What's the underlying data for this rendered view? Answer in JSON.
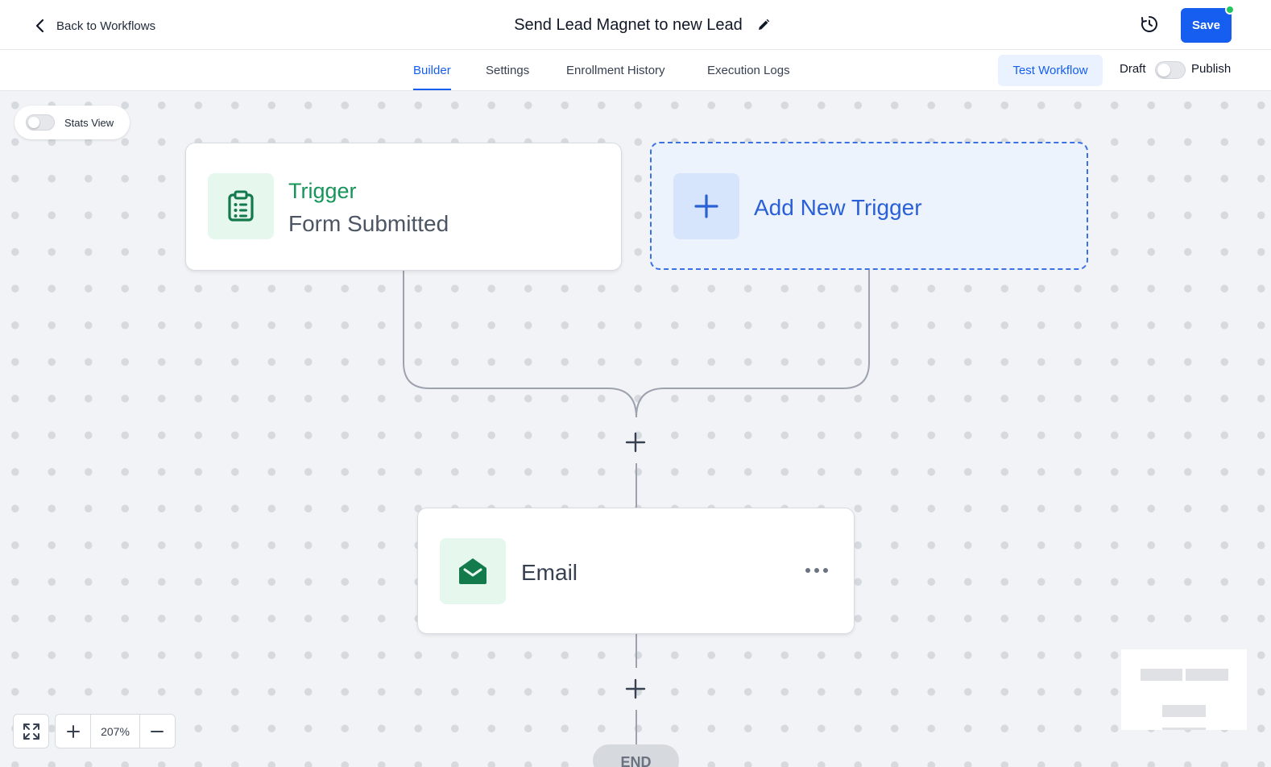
{
  "header": {
    "back_label": "Back to Workflows",
    "title": "Send Lead Magnet to new Lead",
    "save_label": "Save"
  },
  "tabs": [
    {
      "label": "Builder",
      "active": true
    },
    {
      "label": "Settings",
      "active": false
    },
    {
      "label": "Enrollment History",
      "active": false
    },
    {
      "label": "Execution Logs",
      "active": false
    }
  ],
  "toolbar": {
    "test_label": "Test Workflow",
    "draft_label": "Draft",
    "publish_label": "Publish",
    "published": false
  },
  "canvas": {
    "stats_view_label": "Stats View",
    "stats_view_on": false,
    "trigger": {
      "title": "Trigger",
      "subtitle": "Form Submitted",
      "icon": "clipboard-list-icon"
    },
    "add_trigger_label": "Add New Trigger",
    "email": {
      "label": "Email",
      "icon": "envelope-open-icon"
    },
    "end_label": "END",
    "zoom_label": "207%"
  },
  "colors": {
    "accent": "#155eef",
    "trigger_green": "#17945a",
    "canvas_bg": "#f2f3f6",
    "status_dot": "#22c55e"
  }
}
